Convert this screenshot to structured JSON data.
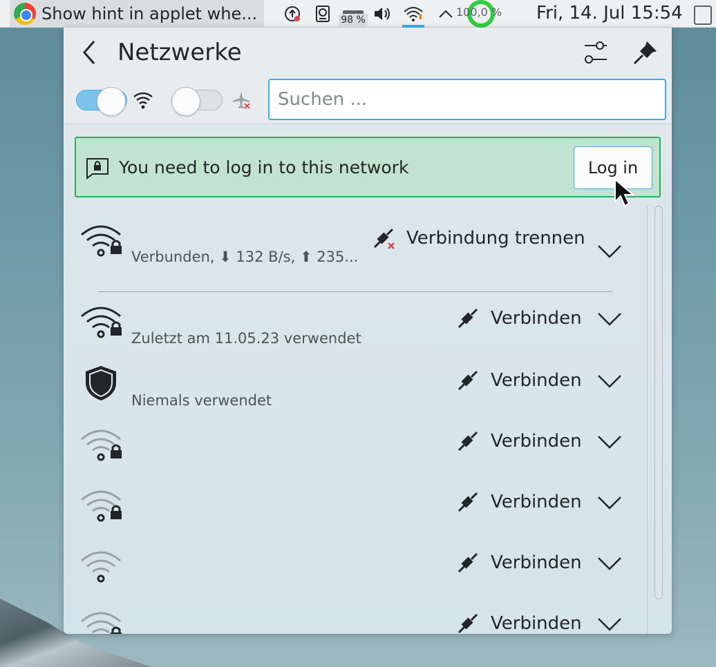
{
  "taskbar": {
    "task_title": "Show hint in applet whe...",
    "battery_percent": "98 %",
    "cpu_label": "100,0 %",
    "clock": "Fri, 14. Jul  15:54"
  },
  "popup": {
    "title": "Netzwerke",
    "search_placeholder": "Suchen ...",
    "wifi_enabled": true,
    "airplane_mode": false,
    "hint": {
      "text": "You need to log in to this network",
      "button_label": "Log in"
    },
    "networks": [
      {
        "icon": "wifi-secure-icon",
        "status": "Verbunden, ⬇ 132 B/s, ⬆ 235...",
        "action": "Verbindung trennen",
        "action_icon": "disconnect-icon"
      },
      {
        "icon": "wifi-secure-icon",
        "status": "Zuletzt am 11.05.23 verwendet",
        "action": "Verbinden",
        "action_icon": "connect-icon"
      },
      {
        "icon": "vpn-shield-icon",
        "status": "Niemals verwendet",
        "action": "Verbinden",
        "action_icon": "connect-icon"
      },
      {
        "icon": "wifi-secure-weak-icon",
        "status": "",
        "action": "Verbinden",
        "action_icon": "connect-icon"
      },
      {
        "icon": "wifi-secure-weak-icon",
        "status": "",
        "action": "Verbinden",
        "action_icon": "connect-icon"
      },
      {
        "icon": "wifi-open-weak-icon",
        "status": "",
        "action": "Verbinden",
        "action_icon": "connect-icon"
      },
      {
        "icon": "wifi-secure-weak-icon",
        "status": "",
        "action": "Verbinden",
        "action_icon": "connect-icon"
      }
    ]
  },
  "colors": {
    "accent": "#3daee9",
    "hint_bg": "#c3e3d1",
    "hint_border": "#27ae60",
    "text": "#232629"
  }
}
